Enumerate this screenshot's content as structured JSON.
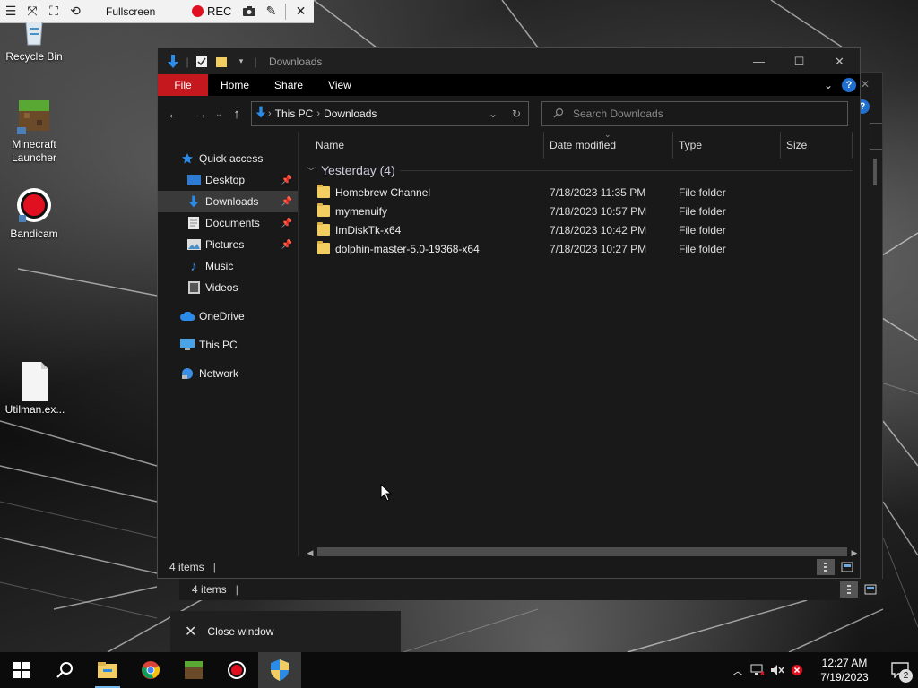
{
  "recorder": {
    "mode_label": "Fullscreen",
    "rec_label": "REC"
  },
  "desktop": {
    "icons": [
      {
        "label": "Recycle Bin"
      },
      {
        "label": "Minecraft Launcher"
      },
      {
        "label": "Bandicam"
      },
      {
        "label": "Utilman.ex..."
      }
    ]
  },
  "explorer": {
    "title": "Downloads",
    "ribbon_tabs": [
      "File",
      "Home",
      "Share",
      "View"
    ],
    "help_label": "?",
    "breadcrumb": [
      "This PC",
      "Downloads"
    ],
    "search_placeholder": "Search Downloads",
    "nav": {
      "quick_access": "Quick access",
      "items": [
        "Desktop",
        "Downloads",
        "Documents",
        "Pictures",
        "Music",
        "Videos"
      ],
      "onedrive": "OneDrive",
      "this_pc": "This PC",
      "network": "Network"
    },
    "columns": [
      "Name",
      "Date modified",
      "Type",
      "Size"
    ],
    "group_label": "Yesterday (4)",
    "files": [
      {
        "name": "Homebrew Channel",
        "date": "7/18/2023 11:35 PM",
        "type": "File folder"
      },
      {
        "name": "mymenuify",
        "date": "7/18/2023 10:57 PM",
        "type": "File folder"
      },
      {
        "name": "ImDiskTk-x64",
        "date": "7/18/2023 10:42 PM",
        "type": "File folder"
      },
      {
        "name": "dolphin-master-5.0-19368-x64",
        "date": "7/18/2023 10:27 PM",
        "type": "File folder"
      }
    ],
    "status": "4 items"
  },
  "background_window": {
    "status": "4 items"
  },
  "jump_list": {
    "close_label": "Close window"
  },
  "taskbar": {
    "time": "12:27 AM",
    "date": "7/19/2023",
    "notification_count": "2"
  },
  "colors": {
    "file_tab": "#c4171e",
    "folder": "#f2cd62",
    "accent": "#1f6fd1",
    "rec": "#e01020"
  }
}
